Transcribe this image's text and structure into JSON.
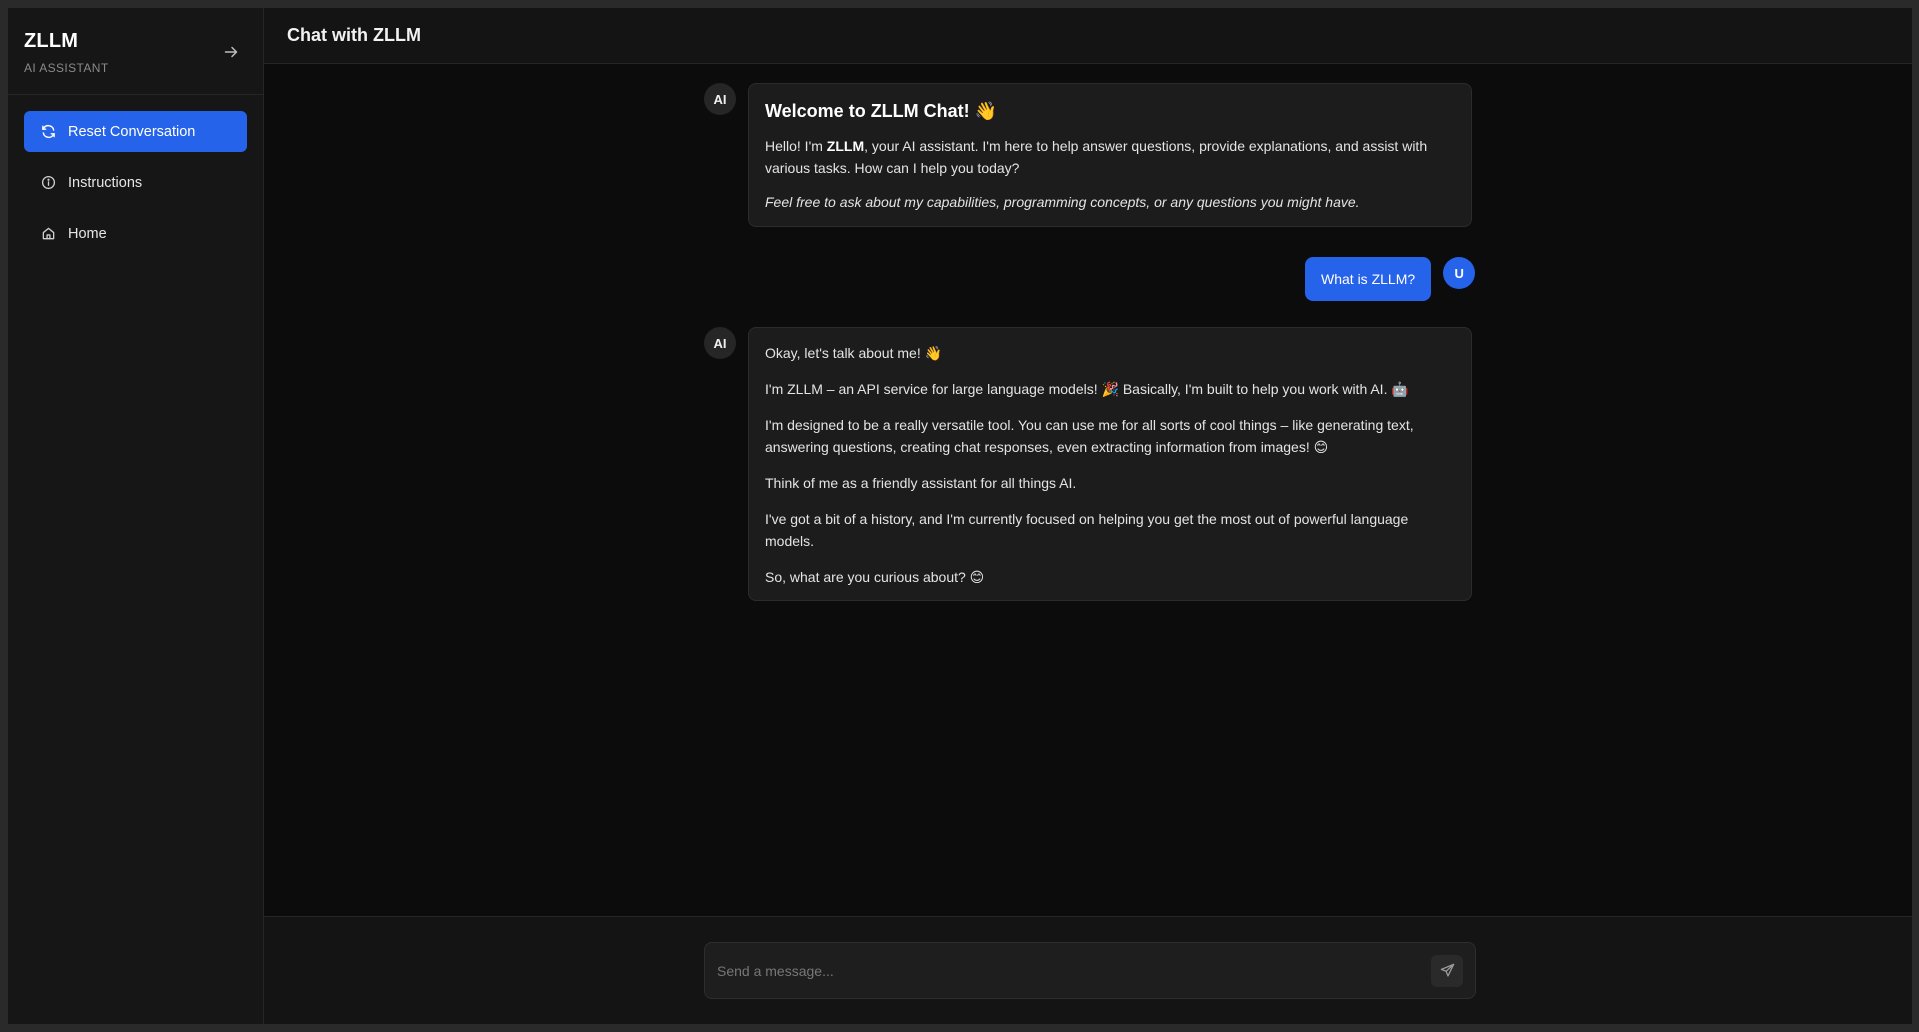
{
  "sidebar": {
    "brand_title": "ZLLM",
    "brand_subtitle": "AI ASSISTANT",
    "items": [
      {
        "label": "Reset Conversation",
        "icon": "refresh-icon",
        "active": true
      },
      {
        "label": "Instructions",
        "icon": "info-icon",
        "active": false
      },
      {
        "label": "Home",
        "icon": "home-icon",
        "active": false
      }
    ]
  },
  "header": {
    "title": "Chat with ZLLM"
  },
  "messages": [
    {
      "role": "ai",
      "avatar": "AI",
      "title": "Welcome to ZLLM Chat! 👋",
      "p1_a": "Hello! I'm ",
      "p1_strong": "ZLLM",
      "p1_b": ", your AI assistant. I'm here to help answer questions, provide explanations, and assist with various tasks. How can I help you today?",
      "p2": "Feel free to ask about my capabilities, programming concepts, or any questions you might have."
    },
    {
      "role": "user",
      "avatar": "U",
      "text": "What is ZLLM?"
    },
    {
      "role": "ai",
      "avatar": "AI",
      "paragraphs": [
        "Okay, let's talk about me! 👋",
        "I'm ZLLM – an API service for large language models! 🎉 Basically, I'm built to help you work with AI. 🤖",
        "I'm designed to be a really versatile tool. You can use me for all sorts of cool things – like generating text, answering questions, creating chat responses, even extracting information from images! 😊",
        "Think of me as a friendly assistant for all things AI.",
        "I've got a bit of a history, and I'm currently focused on helping you get the most out of powerful language models.",
        "So, what are you curious about? 😊"
      ]
    }
  ],
  "composer": {
    "placeholder": "Send a message..."
  },
  "colors": {
    "accent": "#2563eb",
    "background": "#0c0c0c",
    "sidebar": "#161616",
    "bubble": "#1c1c1c"
  }
}
